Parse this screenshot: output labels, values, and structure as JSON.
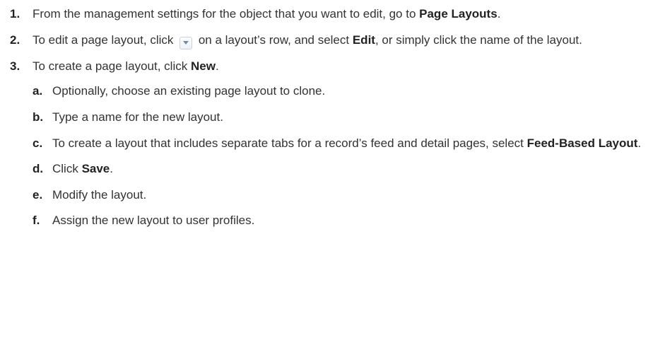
{
  "steps": [
    {
      "number": "1.",
      "text_before": "From the management settings for the object that you want to edit, go to ",
      "bold": "Page Layouts",
      "text_after": "."
    },
    {
      "number": "2.",
      "text_before": "To edit a page layout, click ",
      "icon": "dropdown-arrow-icon",
      "text_middle": " on a layout’s row, and select ",
      "bold": "Edit",
      "text_after": ", or simply click the name of the layout."
    },
    {
      "number": "3.",
      "text_before": "To create a page layout, click ",
      "bold": "New",
      "text_after": ".",
      "substeps": [
        {
          "letter": "a.",
          "text": "Optionally, choose an existing page layout to clone."
        },
        {
          "letter": "b.",
          "text": "Type a name for the new layout."
        },
        {
          "letter": "c.",
          "text_before": "To create a layout that includes separate tabs for a record’s feed and detail pages, select ",
          "bold": "Feed-Based Layout",
          "text_after": "."
        },
        {
          "letter": "d.",
          "text_before": "Click ",
          "bold": "Save",
          "text_after": "."
        },
        {
          "letter": "e.",
          "text": "Modify the layout."
        },
        {
          "letter": "f.",
          "text": "Assign the new layout to user profiles."
        }
      ]
    }
  ],
  "colors": {
    "text": "#333333",
    "strong": "#222222",
    "icon_border": "#c8d3df",
    "icon_arrow": "#6d8cab"
  }
}
